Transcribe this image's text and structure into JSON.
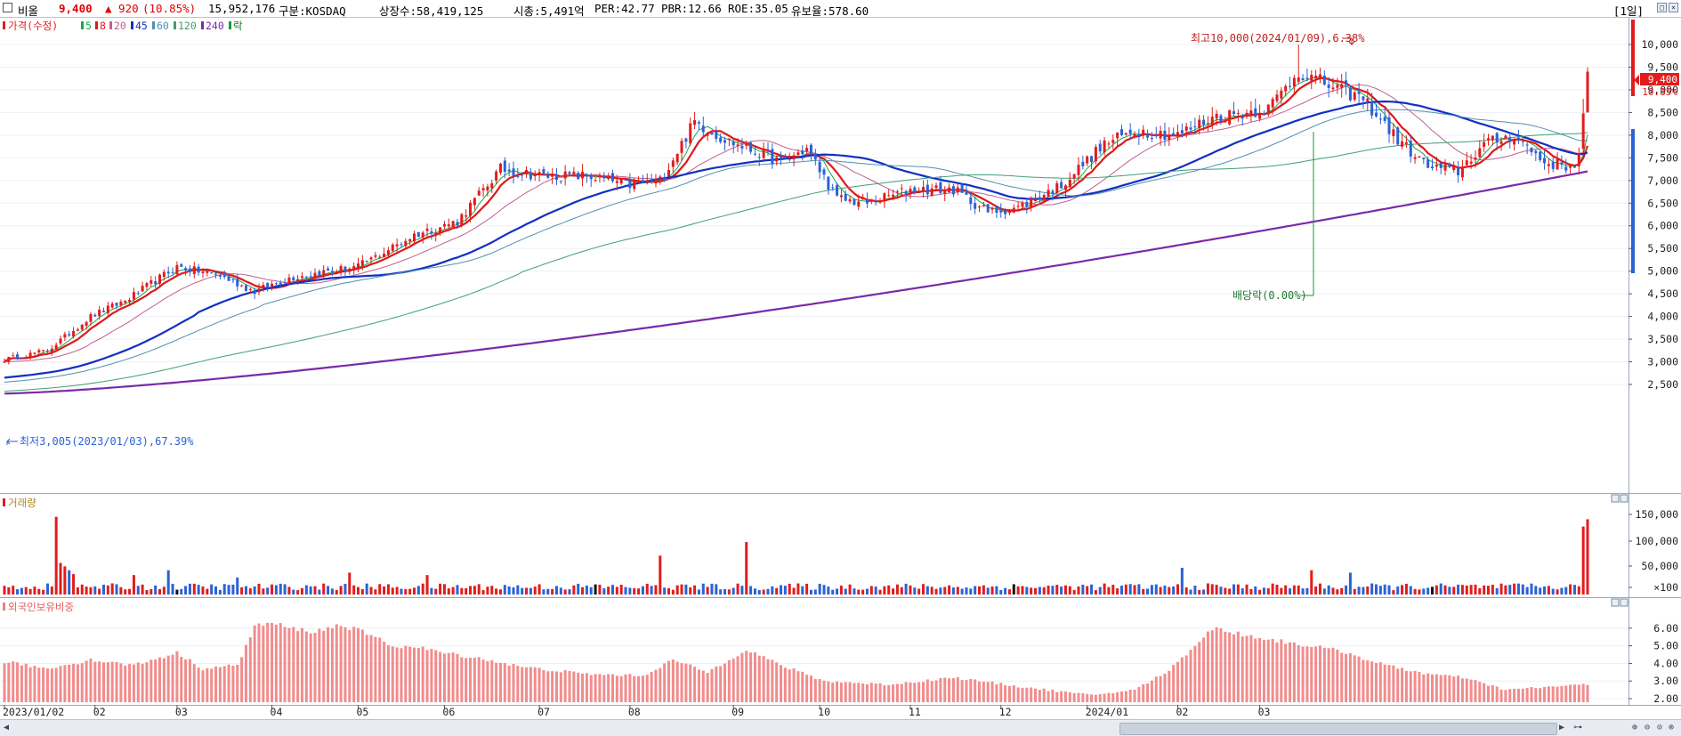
{
  "header": {
    "stock_name": "비올",
    "price": "9,400",
    "change": "▲ 920",
    "change_pct": "(10.85%)",
    "volume": "15,952,176",
    "market": "구분:KOSDAQ",
    "shares": "상장수:58,419,125",
    "market_cap": "시총:5,491억",
    "per": "PER:42.77",
    "pbr": "PBR:12.66",
    "roe": "ROE:35.05",
    "float_ratio": "유보율:578.60",
    "period": "[1일]"
  },
  "legend": {
    "price_label": "가격(수정)",
    "ma": [
      {
        "label": "5",
        "color": "#1aa84a"
      },
      {
        "label": "8",
        "color": "#e01818"
      },
      {
        "label": "20",
        "color": "#c06090"
      },
      {
        "label": "45",
        "color": "#1030c0"
      },
      {
        "label": "60",
        "color": "#5090b0"
      },
      {
        "label": "120",
        "color": "#40a070"
      },
      {
        "label": "240",
        "color": "#7a2aa8"
      }
    ],
    "ex_label": "락"
  },
  "annotations": {
    "high": "최고10,000(2024/01/09),6.38%",
    "low": "최저3,005(2023/01/03),67.39%",
    "dividend": "배당락(0.00%)",
    "current_price_tag": "9,400",
    "current_pct_tag": "10.85%"
  },
  "volume_panel": {
    "title": "거래량"
  },
  "foreign_panel": {
    "title": "외국인보유비중"
  },
  "chart_data": [
    {
      "type": "candlestick",
      "title": "가격(수정)",
      "ylim": [
        2150,
        10400
      ],
      "yticks": [
        "10,000",
        "9,500",
        "9,000",
        "8,500",
        "8,000",
        "7,500",
        "7,000",
        "6,500",
        "6,000",
        "5,500",
        "5,000",
        "4,500",
        "4,000",
        "3,500",
        "3,000",
        "2,500"
      ],
      "xticks": [
        "2023/01/02",
        "02",
        "03",
        "04",
        "05",
        "06",
        "07",
        "08",
        "09",
        "10",
        "11",
        "12",
        "2024/01",
        "02",
        "03"
      ],
      "close_anchors": [
        [
          0,
          3050
        ],
        [
          10,
          3250
        ],
        [
          20,
          4000
        ],
        [
          28,
          4350
        ],
        [
          40,
          5100
        ],
        [
          50,
          4900
        ],
        [
          58,
          4550
        ],
        [
          66,
          4850
        ],
        [
          75,
          5000
        ],
        [
          82,
          5100
        ],
        [
          95,
          5800
        ],
        [
          105,
          6100
        ],
        [
          115,
          7250
        ],
        [
          125,
          7100
        ],
        [
          135,
          7100
        ],
        [
          145,
          6900
        ],
        [
          152,
          7000
        ],
        [
          160,
          8300
        ],
        [
          167,
          7900
        ],
        [
          175,
          7600
        ],
        [
          180,
          7400
        ],
        [
          186,
          7700
        ],
        [
          193,
          6600
        ],
        [
          200,
          6500
        ],
        [
          210,
          6800
        ],
        [
          220,
          6800
        ],
        [
          228,
          6300
        ],
        [
          235,
          6400
        ],
        [
          245,
          6900
        ],
        [
          255,
          7800
        ],
        [
          262,
          8100
        ],
        [
          272,
          8000
        ],
        [
          280,
          8400
        ],
        [
          288,
          8500
        ],
        [
          293,
          8600
        ],
        [
          300,
          9400
        ],
        [
          307,
          9100
        ],
        [
          315,
          8800
        ],
        [
          323,
          7900
        ],
        [
          330,
          7300
        ],
        [
          337,
          7200
        ],
        [
          343,
          7800
        ],
        [
          350,
          8000
        ],
        [
          357,
          7400
        ],
        [
          363,
          7300
        ],
        [
          366,
          7600
        ],
        [
          367,
          9400
        ]
      ],
      "highlights": [
        [
          0,
          3005
        ],
        [
          300,
          10000
        ]
      ],
      "ma_periods": [
        5,
        8,
        20,
        45,
        60,
        120,
        240
      ],
      "ma_start_levels": {
        "20": 3000,
        "45": 2650,
        "60": 2550,
        "120": 2350,
        "240": 2300
      },
      "ma240_end": 7200,
      "ma120_end": 7950
    },
    {
      "type": "bar",
      "title": "거래량",
      "yticks": [
        "150,000",
        "100,000",
        "50,000",
        "×100"
      ],
      "ylim": [
        0,
        165000
      ],
      "base": 9000,
      "spikes": [
        [
          12,
          160000
        ],
        [
          13,
          65000
        ],
        [
          14,
          58000
        ],
        [
          15,
          50000
        ],
        [
          16,
          42000
        ],
        [
          30,
          40000
        ],
        [
          38,
          50000
        ],
        [
          54,
          35000
        ],
        [
          80,
          45000
        ],
        [
          98,
          40000
        ],
        [
          152,
          80000
        ],
        [
          172,
          108000
        ],
        [
          273,
          55000
        ],
        [
          303,
          50000
        ],
        [
          312,
          45000
        ],
        [
          366,
          140000
        ],
        [
          367,
          155000
        ]
      ]
    },
    {
      "type": "bar",
      "title": "외국인보유비중",
      "yticks": [
        "6.00",
        "5.00",
        "4.00",
        "3.00",
        "2.00"
      ],
      "ylim": [
        1.8,
        6.8
      ],
      "anchors": [
        [
          0,
          4.1
        ],
        [
          10,
          3.7
        ],
        [
          20,
          4.2
        ],
        [
          30,
          3.9
        ],
        [
          40,
          4.6
        ],
        [
          46,
          3.7
        ],
        [
          54,
          3.9
        ],
        [
          58,
          6.1
        ],
        [
          62,
          6.3
        ],
        [
          66,
          6.0
        ],
        [
          72,
          5.8
        ],
        [
          78,
          6.2
        ],
        [
          84,
          5.7
        ],
        [
          90,
          5.0
        ],
        [
          96,
          4.9
        ],
        [
          102,
          4.6
        ],
        [
          110,
          4.3
        ],
        [
          120,
          3.8
        ],
        [
          135,
          3.4
        ],
        [
          148,
          3.3
        ],
        [
          155,
          4.2
        ],
        [
          163,
          3.5
        ],
        [
          172,
          4.8
        ],
        [
          180,
          3.9
        ],
        [
          190,
          3.0
        ],
        [
          205,
          2.8
        ],
        [
          220,
          3.2
        ],
        [
          238,
          2.6
        ],
        [
          252,
          2.2
        ],
        [
          262,
          2.5
        ],
        [
          270,
          3.6
        ],
        [
          280,
          6.0
        ],
        [
          290,
          5.5
        ],
        [
          300,
          5.1
        ],
        [
          310,
          4.7
        ],
        [
          320,
          3.9
        ],
        [
          330,
          3.4
        ],
        [
          338,
          3.2
        ],
        [
          348,
          2.5
        ],
        [
          360,
          2.7
        ],
        [
          367,
          2.8
        ]
      ]
    }
  ]
}
